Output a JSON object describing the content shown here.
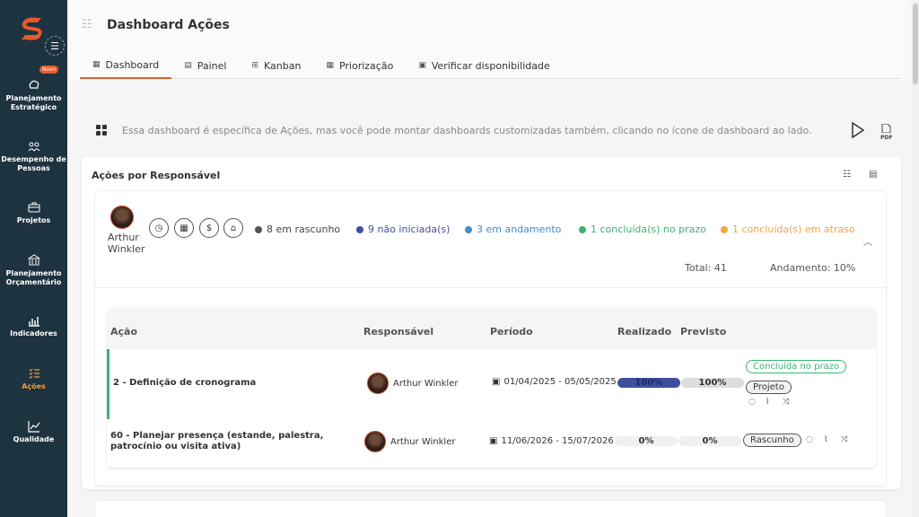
{
  "sidebar": {
    "badge": "Novo",
    "items": [
      {
        "label": "Planejamento Estratégico",
        "icon": "strategy-icon"
      },
      {
        "label": "Desempenho de Pessoas",
        "icon": "people-icon"
      },
      {
        "label": "Projetos",
        "icon": "briefcase-icon"
      },
      {
        "label": "Planejamento Orçamentário",
        "icon": "bank-icon"
      },
      {
        "label": "Indicadores",
        "icon": "bar-chart-icon"
      },
      {
        "label": "Ações",
        "icon": "list-icon",
        "active": true
      },
      {
        "label": "Qualidade",
        "icon": "line-chart-icon"
      }
    ]
  },
  "header": {
    "title": "Dashboard Ações",
    "tabs": [
      {
        "label": "Dashboard",
        "icon": "dashboard-icon",
        "active": true
      },
      {
        "label": "Painel",
        "icon": "panel-icon"
      },
      {
        "label": "Kanban",
        "icon": "kanban-icon"
      },
      {
        "label": "Priorização",
        "icon": "priority-icon"
      },
      {
        "label": "Verificar disponibilidade",
        "icon": "calendar-icon"
      }
    ]
  },
  "info": {
    "text": "Essa dashboard é específica de Ações, mas você pode montar dashboards customizadas também, clicando no ícone de dashboard ao lado.",
    "pdf_label": "PDF"
  },
  "card": {
    "title": "Ações por Responsável",
    "person": {
      "name": "Arthur Winkler",
      "statuses": [
        {
          "label": "8 em rascunho",
          "color": "#555555"
        },
        {
          "label": "9 não iniciada(s)",
          "color": "#3f4f9e"
        },
        {
          "label": "3 em andamento",
          "color": "#3a8fd0"
        },
        {
          "label": "1 concluída(s) no prazo",
          "color": "#3cb371"
        },
        {
          "label": "1 concluída(s) em atraso",
          "color": "#f2a33a"
        }
      ],
      "total": "Total: 41",
      "progress": "Andamento: 10%"
    },
    "table": {
      "headers": [
        "Ação",
        "Responsável",
        "Período",
        "Realizado",
        "Previsto"
      ],
      "rows": [
        {
          "acao": "2 - Definição de cronograma",
          "responsavel": "Arthur Winkler",
          "periodo": "01/04/2025 - 05/05/2025",
          "realizado": "100%",
          "realizado_value": 100,
          "previsto": "100%",
          "status": "Concluída no prazo",
          "tag": "Projeto"
        },
        {
          "acao": "60 - Planejar presença (estande, palestra, patrocínio ou visita ativa)",
          "responsavel": "Arthur Winkler",
          "periodo": "11/06/2026 - 15/07/2026",
          "realizado": "0%",
          "realizado_value": 0,
          "previsto": "0%",
          "tag": "Rascunho"
        }
      ]
    }
  }
}
